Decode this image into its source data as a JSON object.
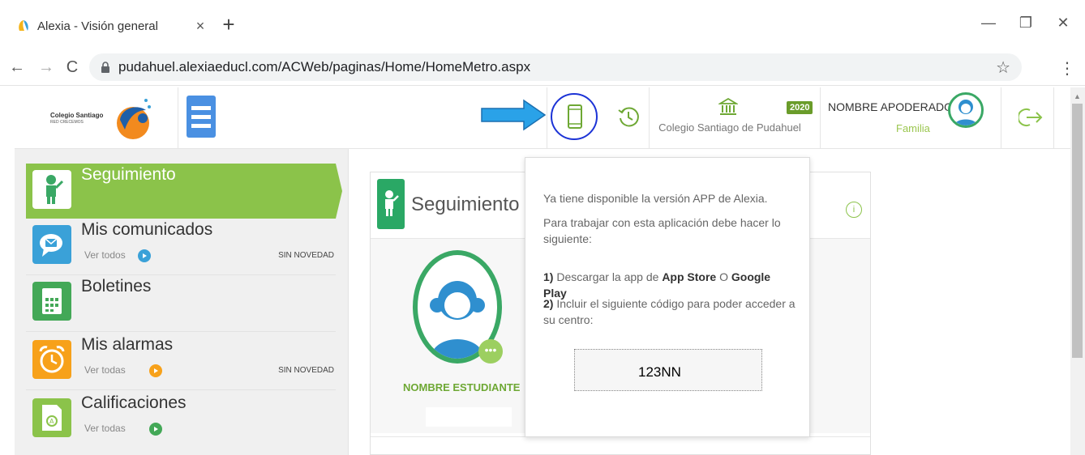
{
  "browser": {
    "tab_title": "Alexia - Visión general",
    "tab_close": "×",
    "new_tab": "+",
    "minimize": "—",
    "restore": "❐",
    "close": "✕",
    "back": "←",
    "forward": "→",
    "reload": "C",
    "url": "pudahuel.alexiaeducl.com/ACWeb/paginas/Home/HomeMetro.aspx",
    "star": "☆",
    "menu": "⋮"
  },
  "header": {
    "logo_text": "Colegio Santiago",
    "logo_subtext": "RED CRECEMOS",
    "school_name": "Colegio Santiago de Pudahuel",
    "year": "2020",
    "parent_name": "NOMBRE APODERADO",
    "parent_role": "Familia"
  },
  "sidebar": {
    "items": [
      {
        "title": "Seguimiento",
        "sub": "",
        "status": "",
        "color": "#8bc34a"
      },
      {
        "title": "Mis comunicados",
        "sub": "Ver todos",
        "status": "SIN NOVEDAD",
        "color": "#3aa1d8"
      },
      {
        "title": "Boletines",
        "sub": "",
        "status": "",
        "color": "#43a857"
      },
      {
        "title": "Mis alarmas",
        "sub": "Ver todas",
        "status": "SIN NOVEDAD",
        "color": "#f7a11a"
      },
      {
        "title": "Calificaciones",
        "sub": "Ver todas",
        "status": "",
        "color": "#8bc34a"
      }
    ]
  },
  "main": {
    "card_title": "Seguimiento",
    "info": "i",
    "student_name": "NOMBRE ESTUDIANTE",
    "chat": "•••"
  },
  "popup": {
    "line1": "Ya tiene disponible la versión APP de Alexia.",
    "line2": "Para trabajar con esta aplicación debe hacer lo siguiente:",
    "step1_num": "1)",
    "step1_pre": "Descargar la app de",
    "step1_store1": "App Store",
    "step1_or": "O",
    "step1_store2": "Google Play",
    "step2_num": "2)",
    "step2_text": "Incluir el siguiente código para poder acceder a su centro:",
    "code": "123NN"
  },
  "colors": {
    "accent_green": "#8bc34a",
    "highlight_circle": "#1c33d6",
    "arrow_blue": "#2aa2e8",
    "menu_blue": "#4a90e2"
  }
}
